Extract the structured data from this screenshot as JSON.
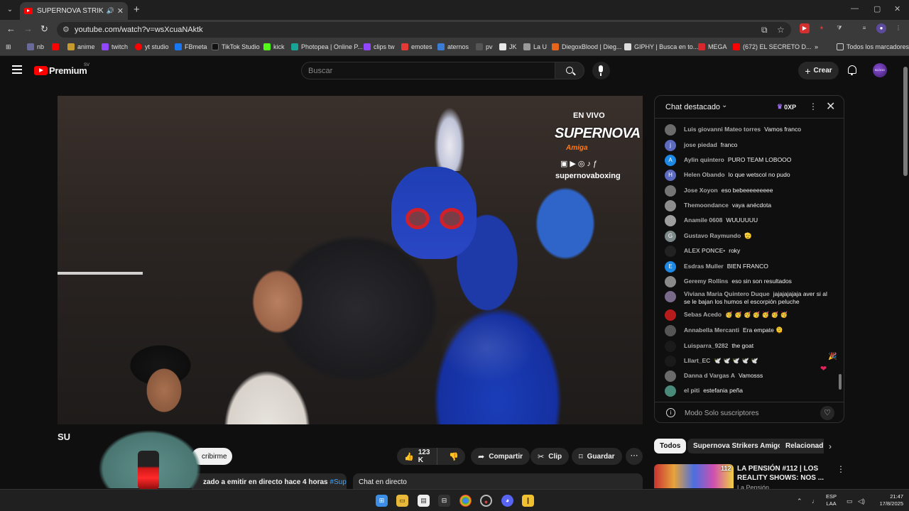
{
  "browser": {
    "tab_title": "SUPERNOVA STRIKERS AMI",
    "url": "youtube.com/watch?v=wsXcuaNAktk",
    "bookmarks": [
      "nb",
      "anime",
      "twitch",
      "yt studio",
      "FBmeta",
      "TikTok Studio",
      "kick",
      "Photopea | Online P...",
      "clips tw",
      "emotes",
      "aternos",
      "pv",
      "JK",
      "La U",
      "DiegoxBlood | Dieg...",
      "GIPHY | Busca en to...",
      "MEGA",
      "(672) EL SECRETO D..."
    ],
    "all_bookmarks_label": "Todos los marcadores"
  },
  "header": {
    "brand": "Premium",
    "country": "SV",
    "search_placeholder": "Buscar",
    "create_label": "Crear",
    "avatar_text": "BLOOD"
  },
  "video": {
    "overlay_live": "EN VIVO",
    "overlay_brand": "SUPERNOVA",
    "overlay_sub": "Amiga",
    "overlay_handle": "supernovaboxing",
    "title_cut": "SU",
    "subscribe_label": "cribirme",
    "likes": "123 K",
    "share_label": "Compartir",
    "clip_label": "Clip",
    "save_label": "Guardar",
    "description": "zado a emitir en directo hace 4 horas",
    "description_tag": "#Super",
    "chat_replay": "Chat en directo"
  },
  "chat": {
    "title": "Chat destacado",
    "xp": "0XP",
    "footer": "Modo Solo suscriptores",
    "messages": [
      {
        "author": "Luis giovanni Mateo torres",
        "text": "Vamos franco",
        "avatar": "",
        "color": "#6b6b6b"
      },
      {
        "author": "jose piedad",
        "text": "franco",
        "avatar": "j",
        "color": "#5c6bc0"
      },
      {
        "author": "Aylin quintero",
        "text": "PURO TEAM LOBOOO",
        "avatar": "A",
        "color": "#1e88e5"
      },
      {
        "author": "Helen Obando",
        "text": "lo que wetscol no pudo",
        "avatar": "H",
        "color": "#5c6bc0"
      },
      {
        "author": "Jose Xoyon",
        "text": "eso bebeeeeeeeee",
        "avatar": "",
        "color": "#757575"
      },
      {
        "author": "Themoondance",
        "text": "vaya anécdota",
        "avatar": "",
        "color": "#8d8d8d"
      },
      {
        "author": "Anamile 0608",
        "text": "WUUUUUU",
        "avatar": "",
        "color": "#9e9e9e"
      },
      {
        "author": "Gustavo Raymundo",
        "text": "🫡",
        "avatar": "G",
        "color": "#7e8a8a"
      },
      {
        "author": "ALEX PONCE•",
        "text": "roky",
        "avatar": "",
        "color": "#222222"
      },
      {
        "author": "Esdras Muller",
        "text": "BIEN FRANCO",
        "avatar": "E",
        "color": "#1e88e5"
      },
      {
        "author": "Geremy Rollins",
        "text": "eso sin son resultados",
        "avatar": "",
        "color": "#8a8a8a"
      },
      {
        "author": "Viviana Maria Quintero Duque",
        "text": "jajajajajaja aver si al se le bajan los humos el escorpión peluche",
        "avatar": "",
        "color": "#7a6a8a"
      },
      {
        "author": "Sebas Acedo",
        "text": "🥳 🥳 🥳 🥳 🥳 🥳 🥳",
        "avatar": "",
        "color": "#b71c1c"
      },
      {
        "author": "Annabella Mercanti",
        "text": "Era empate 🫠",
        "avatar": "",
        "color": "#555555"
      },
      {
        "author": "Luisparra_9282",
        "text": "the goat",
        "avatar": "",
        "color": "#1a1a1a"
      },
      {
        "author": "Lllart_EC",
        "text": "🕊️ 🕊️ 🕊️ 🕊️ 🕊️",
        "avatar": "",
        "color": "#1a1a1a"
      },
      {
        "author": "Danna d Vargas A",
        "text": "Vamosss",
        "avatar": "",
        "color": "#6a6a6a"
      },
      {
        "author": "el piti",
        "text": "estefania peña",
        "avatar": "",
        "color": "#4a8a7a"
      }
    ]
  },
  "suggestions": {
    "chips": [
      "Todos",
      "Supernova Strikers Amigo",
      "Relacionad"
    ],
    "video_title": "LA PENSIÓN #112 | LOS REALITY SHOWS: NOS ...",
    "video_badge": "112",
    "video_channel": "La Pensión"
  },
  "taskbar": {
    "lang": "ESP",
    "lang_sub": "LAA",
    "time": "21:47",
    "date": "17/8/2025"
  }
}
